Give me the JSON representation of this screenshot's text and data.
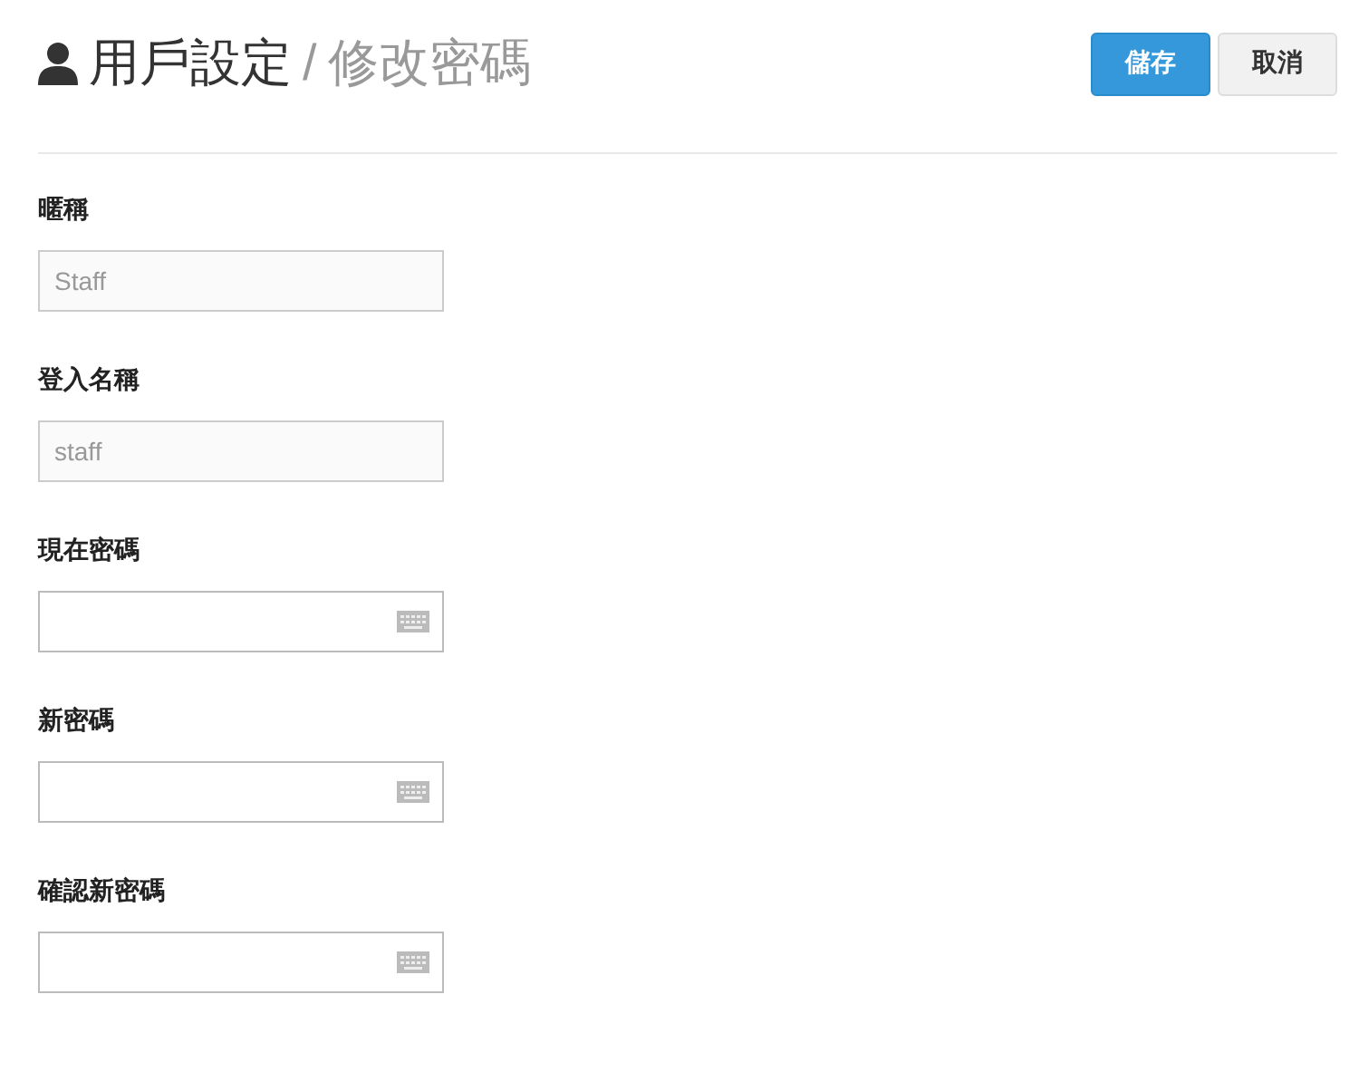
{
  "header": {
    "title": "用戶設定",
    "separator": "/",
    "subtitle": "修改密碼"
  },
  "buttons": [
    {
      "label": "儲存",
      "kind": "primary"
    },
    {
      "label": "取消",
      "kind": "default"
    }
  ],
  "fields": [
    {
      "label": "暱稱",
      "kind": "text",
      "value": "Staff",
      "disabled": true
    },
    {
      "label": "登入名稱",
      "kind": "text",
      "value": "staff",
      "disabled": true
    },
    {
      "label": "現在密碼",
      "kind": "password",
      "disabled": false
    },
    {
      "label": "新密碼",
      "kind": "password",
      "disabled": false
    },
    {
      "label": "確認新密碼",
      "kind": "password",
      "disabled": false
    }
  ]
}
